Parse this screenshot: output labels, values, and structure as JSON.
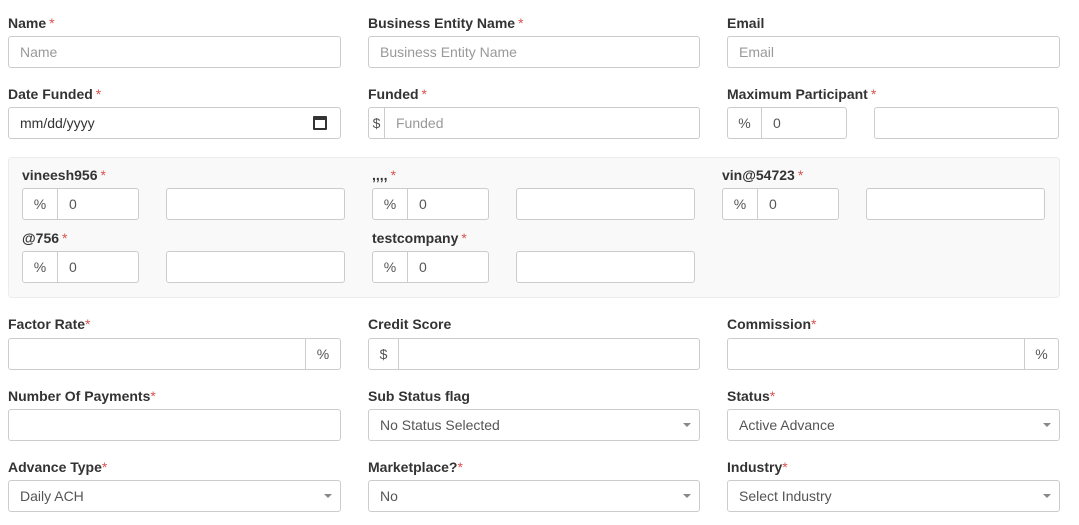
{
  "fields": {
    "name": {
      "label": "Name",
      "placeholder": "Name",
      "required_mark": "*"
    },
    "business_entity_name": {
      "label": "Business Entity Name",
      "placeholder": "Business Entity Name",
      "required_mark": "*"
    },
    "email": {
      "label": "Email",
      "placeholder": "Email"
    },
    "date_funded": {
      "label": "Date Funded",
      "value": "mm/dd/yyyy",
      "required_mark": "*"
    },
    "funded": {
      "label": "Funded",
      "prefix": "$",
      "placeholder": "Funded",
      "required_mark": "*"
    },
    "maximum_participant": {
      "label": "Maximum Participant",
      "prefix": "%",
      "value": "0",
      "required_mark": "*"
    }
  },
  "participants": [
    {
      "label": "vineesh956",
      "required_mark": "*",
      "prefix": "%",
      "value": "0"
    },
    {
      "label": ",,,,",
      "required_mark": "*",
      "prefix": "%",
      "value": "0"
    },
    {
      "label": "vin@54723",
      "required_mark": "*",
      "prefix": "%",
      "value": "0"
    },
    {
      "label": "@756",
      "required_mark": "*",
      "prefix": "%",
      "value": "0"
    },
    {
      "label": "testcompany",
      "required_mark": "*",
      "prefix": "%",
      "value": "0"
    }
  ],
  "fields2": {
    "factor_rate": {
      "label": "Factor Rate",
      "suffix": "%",
      "required_mark": "*"
    },
    "credit_score": {
      "label": "Credit Score",
      "prefix": "$"
    },
    "commission": {
      "label": "Commission",
      "suffix": "%",
      "required_mark": "*"
    },
    "number_of_payments": {
      "label": "Number Of Payments",
      "required_mark": "*"
    },
    "sub_status_flag": {
      "label": "Sub Status flag",
      "selected": "No Status Selected"
    },
    "status": {
      "label": "Status",
      "selected": "Active Advance",
      "required_mark": "*"
    },
    "advance_type": {
      "label": "Advance Type",
      "selected": "Daily ACH",
      "required_mark": "*"
    },
    "marketplace": {
      "label": "Marketplace?",
      "selected": "No",
      "required_mark": "*"
    },
    "industry": {
      "label": "Industry",
      "selected": "Select Industry",
      "required_mark": "*"
    }
  }
}
